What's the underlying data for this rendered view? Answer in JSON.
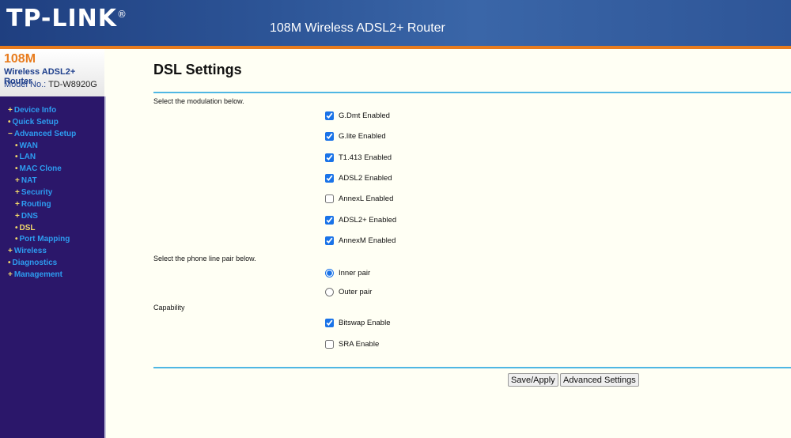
{
  "header": {
    "logo": "TP-LINK",
    "title": "108M Wireless ADSL2+ Router"
  },
  "sidebar_top": {
    "speed": "108M",
    "product": "Wireless ADSL2+ Router",
    "model_label": "Model No.:",
    "model": "TD-W8920G"
  },
  "nav": [
    {
      "label": "Device Info",
      "bullet": "+",
      "level": 0
    },
    {
      "label": "Quick Setup",
      "bullet": "•",
      "level": 0
    },
    {
      "label": "Advanced Setup",
      "bullet": "−",
      "level": 0
    },
    {
      "label": "WAN",
      "bullet": "•",
      "level": 1
    },
    {
      "label": "LAN",
      "bullet": "•",
      "level": 1
    },
    {
      "label": "MAC Clone",
      "bullet": "•",
      "level": 1
    },
    {
      "label": "NAT",
      "bullet": "+",
      "level": 1
    },
    {
      "label": "Security",
      "bullet": "+",
      "level": 1
    },
    {
      "label": "Routing",
      "bullet": "+",
      "level": 1
    },
    {
      "label": "DNS",
      "bullet": "+",
      "level": 1
    },
    {
      "label": "DSL",
      "bullet": "•",
      "level": 1,
      "active": true
    },
    {
      "label": "Port Mapping",
      "bullet": "•",
      "level": 1
    },
    {
      "label": "Wireless",
      "bullet": "+",
      "level": 0
    },
    {
      "label": "Diagnostics",
      "bullet": "•",
      "level": 0
    },
    {
      "label": "Management",
      "bullet": "+",
      "level": 0
    }
  ],
  "main": {
    "title": "DSL Settings",
    "modulation_label": "Select the modulation below.",
    "modulations": [
      {
        "label": "G.Dmt Enabled",
        "checked": true
      },
      {
        "label": "G.lite Enabled",
        "checked": true
      },
      {
        "label": "T1.413 Enabled",
        "checked": true
      },
      {
        "label": "ADSL2 Enabled",
        "checked": true
      },
      {
        "label": "AnnexL Enabled",
        "checked": false
      },
      {
        "label": "ADSL2+ Enabled",
        "checked": true
      },
      {
        "label": "AnnexM Enabled",
        "checked": true
      }
    ],
    "pair_label": "Select the phone line pair below.",
    "pairs": [
      {
        "label": "Inner pair",
        "checked": true
      },
      {
        "label": "Outer pair",
        "checked": false
      }
    ],
    "capability_label": "Capability",
    "capabilities": [
      {
        "label": "Bitswap Enable",
        "checked": true
      },
      {
        "label": "SRA Enable",
        "checked": false
      }
    ],
    "save_label": "Save/Apply",
    "advanced_label": "Advanced Settings"
  }
}
